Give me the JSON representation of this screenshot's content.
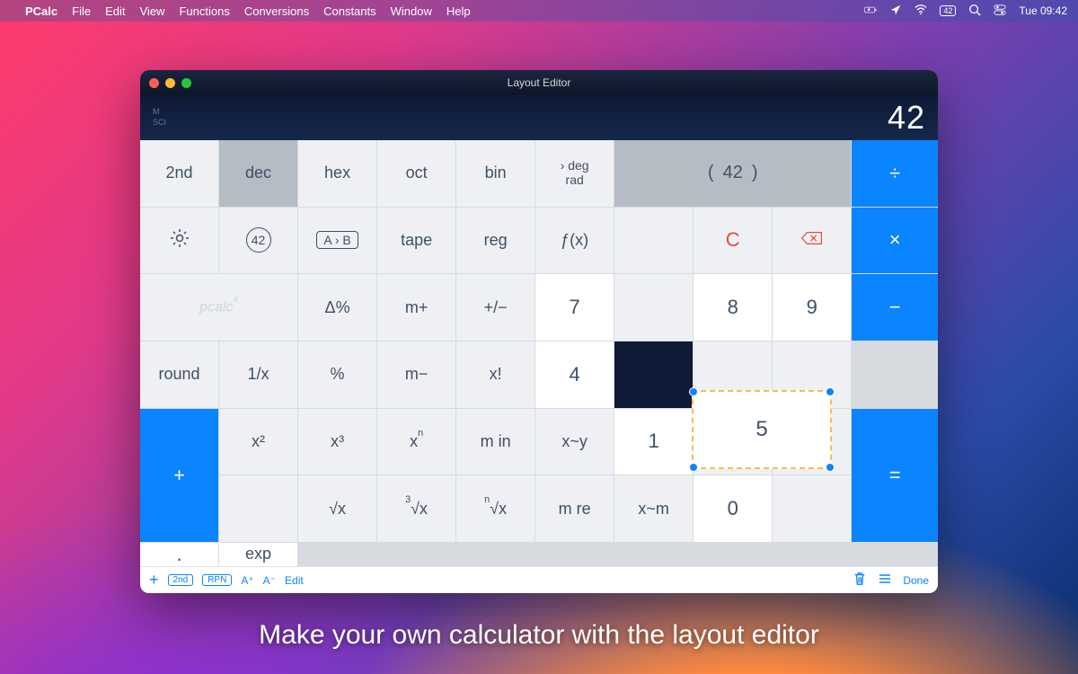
{
  "menubar": {
    "app": "PCalc",
    "items": [
      "File",
      "Edit",
      "View",
      "Functions",
      "Conversions",
      "Constants",
      "Window",
      "Help"
    ],
    "clock": "Tue 09:42",
    "badge": "42"
  },
  "window": {
    "title": "Layout Editor",
    "modes": {
      "m": "M",
      "sci": "SCI"
    },
    "display_value": "42"
  },
  "keys": {
    "r0": {
      "second": "2nd",
      "dec": "dec",
      "hex": "hex",
      "oct": "oct",
      "bin": "bin",
      "angle_top": "› deg",
      "angle_bot": "rad",
      "mem_open": "(",
      "mem_val": "42",
      "mem_close": ")",
      "div": "÷"
    },
    "r1": {
      "gear": "settings",
      "fortytwo": "42",
      "ab": "A › B",
      "tape": "tape",
      "reg": "reg",
      "fx": "ƒ(x)",
      "clear": "C",
      "back": "delete",
      "mul": "×"
    },
    "r2": {
      "brand": "pcalc",
      "brand_sup": "4",
      "dpct": "Δ%",
      "mplus": "m+",
      "pm": "+/−",
      "k7": "7",
      "k8": "8",
      "k9": "9",
      "minus": "−"
    },
    "r3": {
      "round": "round",
      "inv": "1/x",
      "pct": "%",
      "mminus": "m−",
      "fact": "x!",
      "k4": "4",
      "plus": "+"
    },
    "r4": {
      "x2": "x²",
      "x3": "x³",
      "xn_base": "x",
      "xn_sup": "n",
      "min": "m in",
      "xswap": "x~y",
      "k1": "1",
      "eq": "="
    },
    "r5": {
      "sqrt": "√x",
      "cbrt_pre": "3",
      "cbrt": "√x",
      "nroot_pre": "n",
      "nroot": "√x",
      "mre": "m re",
      "xm": "x~m",
      "k0": "0",
      "dot": ".",
      "exp": "exp"
    },
    "floating": "5"
  },
  "toolbar": {
    "plus": "+",
    "second": "2nd",
    "rpn": "RPN",
    "aplus": "A⁺",
    "aminus": "A⁻",
    "edit": "Edit",
    "done": "Done"
  },
  "caption": "Make your own calculator with the layout editor"
}
